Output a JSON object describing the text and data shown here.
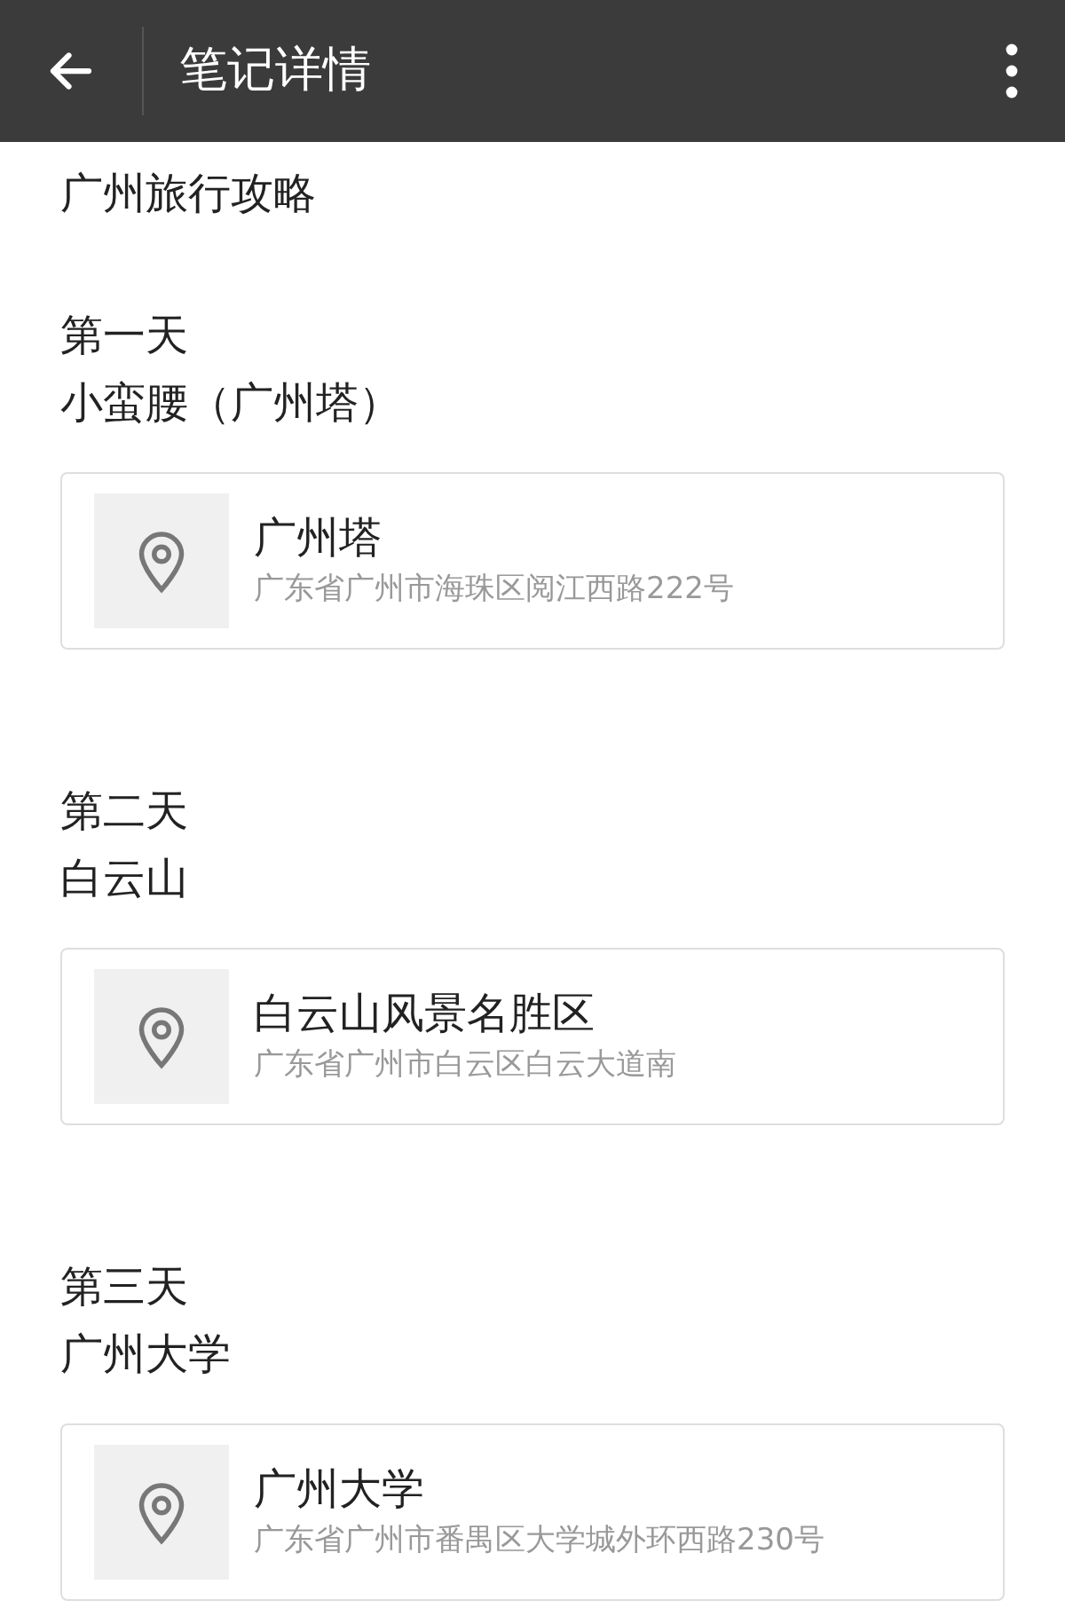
{
  "header": {
    "title": "笔记详情"
  },
  "note": {
    "title": "广州旅行攻略"
  },
  "days": [
    {
      "day": "第一天",
      "place": "小蛮腰（广州塔）",
      "location": {
        "name": "广州塔",
        "address": "广东省广州市海珠区阅江西路222号"
      }
    },
    {
      "day": "第二天",
      "place": "白云山",
      "location": {
        "name": "白云山风景名胜区",
        "address": "广东省广州市白云区白云大道南"
      }
    },
    {
      "day": "第三天",
      "place": "广州大学",
      "location": {
        "name": "广州大学",
        "address": "广东省广州市番禺区大学城外环西路230号"
      }
    }
  ]
}
